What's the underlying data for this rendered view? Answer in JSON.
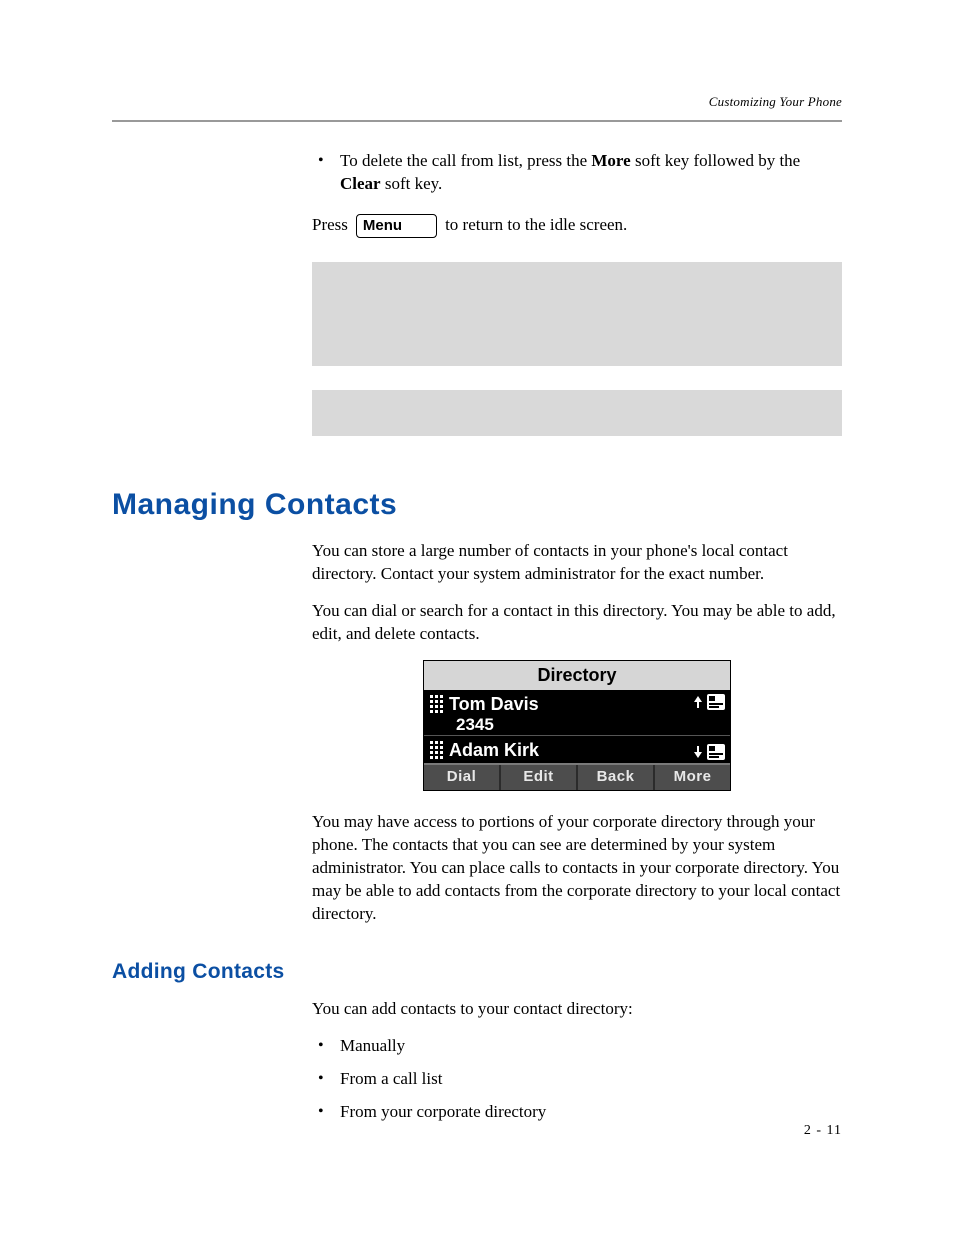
{
  "header": {
    "section_label": "Customizing Your Phone"
  },
  "top_block": {
    "bullet_prefix": "To delete the call from list, press the ",
    "bold1": "More",
    "mid1": " soft key followed by the ",
    "bold2": "Clear",
    "suffix": " soft key.",
    "press_before": "Press ",
    "menu_label": "Menu",
    "press_after": " to return to the idle screen."
  },
  "h1": "Managing Contacts",
  "para1": "You can store a large number of contacts in your phone's local contact directory. Contact your system administrator for the exact number.",
  "para2": "You can dial or search for a contact in this directory. You may be able to add, edit, and delete contacts.",
  "directory": {
    "title": "Directory",
    "rows": [
      {
        "name": "Tom Davis",
        "number": "2345"
      },
      {
        "name": "Adam Kirk",
        "number": ""
      }
    ],
    "softkeys": [
      "Dial",
      "Edit",
      "Back",
      "More"
    ]
  },
  "para3": "You may have access to portions of your corporate directory through your phone. The contacts that you can see are determined by your system administrator. You can place calls to contacts in your corporate directory. You may be able to add contacts from the corporate directory to your local contact directory.",
  "h2": "Adding Contacts",
  "para4": "You can add contacts to your contact directory:",
  "add_bullets": [
    "Manually",
    "From a call list",
    "From your corporate directory"
  ],
  "page_number": "2 - 11"
}
